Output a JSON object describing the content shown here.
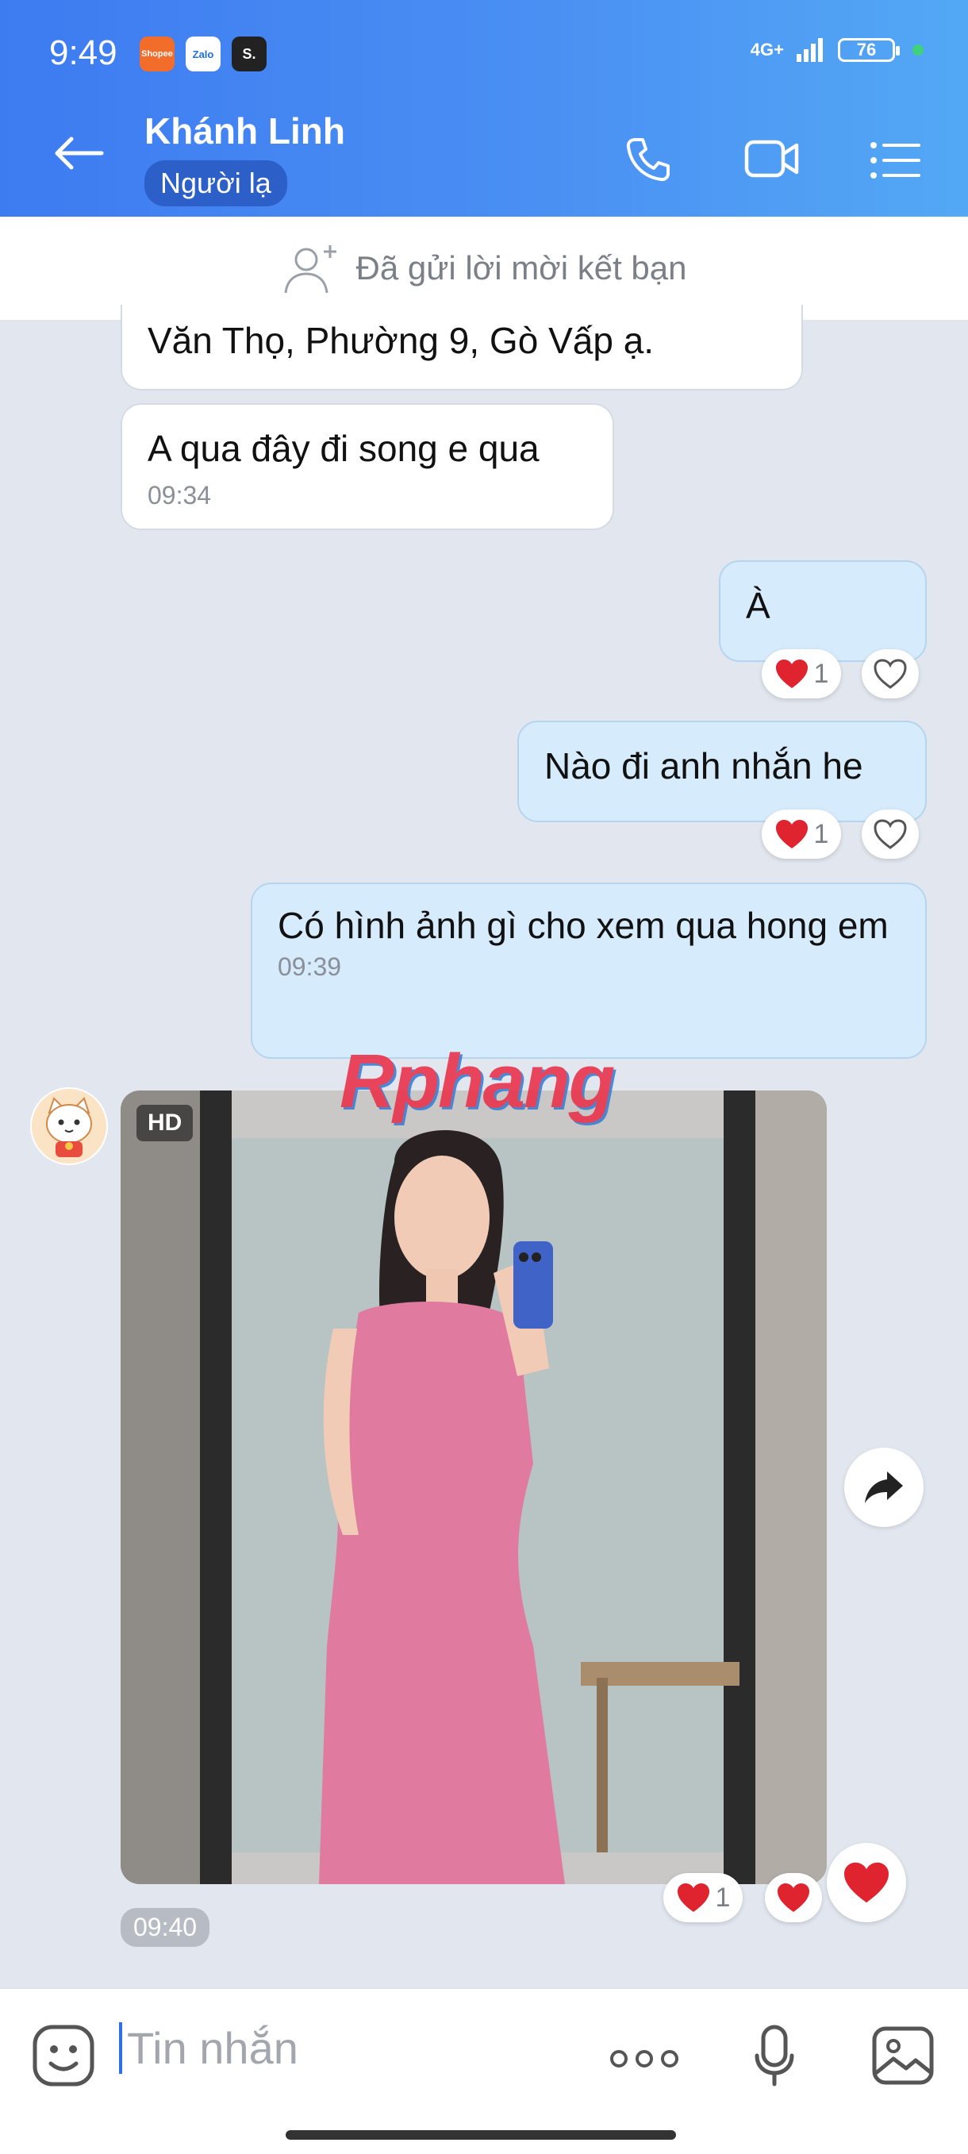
{
  "status_bar": {
    "time": "9:49",
    "apps": [
      "Shopee",
      "Zalo",
      "S."
    ],
    "network": "4G+",
    "battery": "76"
  },
  "header": {
    "name": "Khánh Linh",
    "badge": "Người lạ"
  },
  "friend_request": {
    "text": "Đã gửi lời mời kết bạn"
  },
  "messages": {
    "m1": {
      "text": "Văn Thọ, Phường 9, Gò Vấp ạ."
    },
    "m2": {
      "text": "A qua đây đi song e qua",
      "time": "09:34"
    },
    "m3": {
      "text": "À",
      "reaction_count": "1"
    },
    "m4": {
      "text": "Nào đi anh nhắn he",
      "reaction_count": "1"
    },
    "m5": {
      "text": "Có hình ảnh gì cho xem qua hong em",
      "time": "09:39"
    },
    "photo": {
      "badge": "HD",
      "time": "09:40",
      "reaction_count": "1"
    }
  },
  "watermark": "Rphang",
  "composer": {
    "placeholder": "Tin nhắn"
  },
  "colors": {
    "header_start": "#3d7bf1",
    "header_end": "#53a8f5",
    "outgoing": "#d6ebfc",
    "heart": "#e0242f"
  }
}
